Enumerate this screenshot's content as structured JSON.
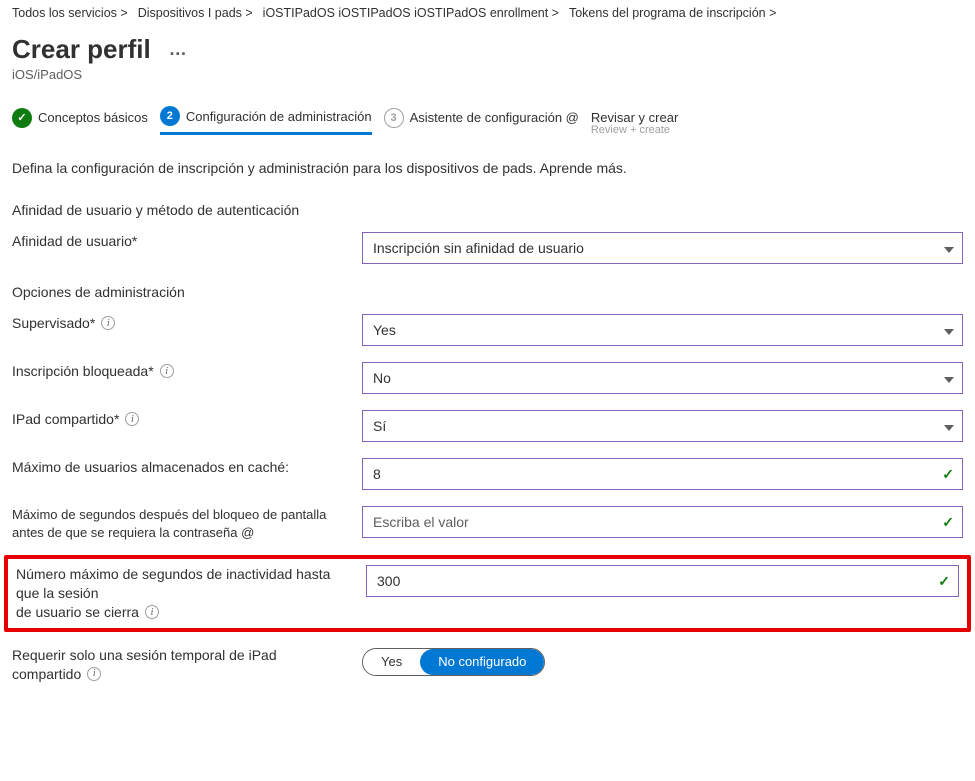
{
  "breadcrumb": {
    "items": [
      "Todos los servicios >",
      "Dispositivos I pads >",
      "iOSTIPadOS iOSTIPadOS iOSTIPadOS enrollment >",
      "Tokens del programa de inscripción >"
    ]
  },
  "page": {
    "title": "Crear perfil",
    "subtitle": "iOS/iPadOS",
    "more_label": "…"
  },
  "wizard": {
    "step1": {
      "label": "Conceptos básicos",
      "num": "✓"
    },
    "step2": {
      "label": "Configuración de administración",
      "num": "2"
    },
    "step3": {
      "label": "Asistente de configuración @",
      "num": "3"
    },
    "step4": {
      "label": "Revisar y crear",
      "ghost": "Review + create"
    }
  },
  "intro": "Defina la configuración de inscripción y administración para los dispositivos de pads. Aprende más.",
  "section_auth": "Afinidad de usuario y método de autenticación",
  "section_mgmt": "Opciones de administración",
  "fields": {
    "user_affinity": {
      "label": "Afinidad de usuario*",
      "value": "Inscripción sin afinidad de usuario"
    },
    "supervised": {
      "label": "Supervisado*",
      "value": "Yes"
    },
    "locked": {
      "label": "Inscripción bloqueada*",
      "value": "No"
    },
    "shared_ipad": {
      "label": "IPad compartido*",
      "value": "Sí"
    },
    "max_cached_users": {
      "label": "Máximo de usuarios almacenados en caché:",
      "value": "8"
    },
    "max_seconds_lock": {
      "label_line1": "Máximo de segundos después del bloqueo de pantalla",
      "label_line2": "antes de que se requiera la contraseña @",
      "placeholder": "Escriba el valor"
    },
    "max_inactivity": {
      "label_line1": "Número máximo de segundos de inactividad hasta que la sesión",
      "label_line2": "de usuario se cierra",
      "value": "300"
    },
    "require_temp": {
      "label_line1": "Requerir solo una sesión temporal de iPad",
      "label_line2": "compartido",
      "opt_yes": "Yes",
      "opt_no": "No configurado"
    }
  }
}
